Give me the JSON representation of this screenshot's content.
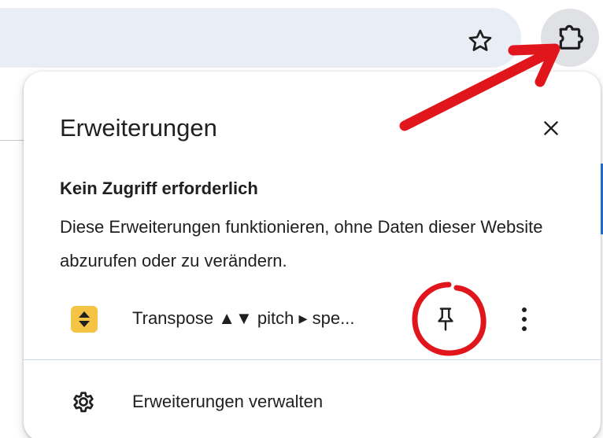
{
  "browser": {
    "bookmark_icon": "star-outline-icon",
    "extensions_icon": "puzzle-piece-icon"
  },
  "popup": {
    "title": "Erweiterungen",
    "close_icon": "close-icon",
    "section": {
      "heading": "Kein Zugriff erforderlich",
      "description": "Diese Erweiterungen funktionieren, ohne Daten dieser Website abzurufen oder zu verändern."
    },
    "extension": {
      "name": "Transpose ▲▼ pitch ▸ spe...",
      "icon": "transpose-extension-icon",
      "icon_color": "#f6c445",
      "pin_icon": "pin-icon",
      "menu_icon": "more-vert-icon"
    },
    "manage": {
      "label": "Erweiterungen verwalten",
      "icon": "gear-icon"
    }
  },
  "annotations": {
    "color": "#e0161c",
    "arrow": "arrow-to-extensions-button",
    "circle": "circle-around-pin-button"
  }
}
